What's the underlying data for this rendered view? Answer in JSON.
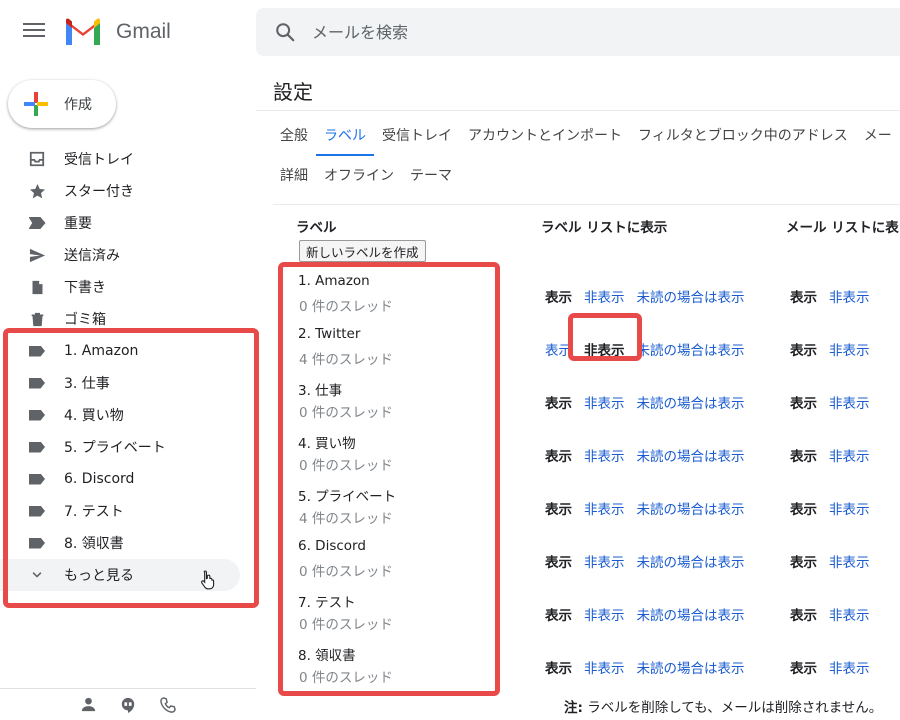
{
  "app": {
    "name": "Gmail"
  },
  "search": {
    "placeholder": "メールを検索"
  },
  "compose": {
    "label": "作成"
  },
  "sidebar": {
    "items": [
      {
        "label": "受信トレイ",
        "icon": "inbox-icon"
      },
      {
        "label": "スター付き",
        "icon": "star-icon"
      },
      {
        "label": "重要",
        "icon": "important-icon"
      },
      {
        "label": "送信済み",
        "icon": "send-icon"
      },
      {
        "label": "下書き",
        "icon": "draft-icon"
      },
      {
        "label": "ゴミ箱",
        "icon": "trash-icon"
      },
      {
        "label": "1. Amazon",
        "icon": "label-icon"
      },
      {
        "label": "3. 仕事",
        "icon": "label-icon"
      },
      {
        "label": "4. 買い物",
        "icon": "label-icon"
      },
      {
        "label": "5. プライベート",
        "icon": "label-icon"
      },
      {
        "label": "6. Discord",
        "icon": "label-icon"
      },
      {
        "label": "7. テスト",
        "icon": "label-icon"
      },
      {
        "label": "8. 領収書",
        "icon": "label-icon"
      }
    ],
    "more_label": "もっと見る"
  },
  "settings": {
    "title": "設定",
    "tabs_row1": [
      "全般",
      "ラベル",
      "受信トレイ",
      "アカウントとインポート",
      "フィルタとブロック中のアドレス",
      "メー"
    ],
    "tabs_row2": [
      "詳細",
      "オフライン",
      "テーマ"
    ],
    "active_tab": "ラベル",
    "headers": {
      "label": "ラベル",
      "label_list": "ラベル リストに表示",
      "message_list": "メール リストに表"
    },
    "new_label_button": "新しいラベルを作成",
    "options": {
      "show": "表示",
      "hide": "非表示",
      "show_if_unread": "未読の場合は表示"
    },
    "labels": [
      {
        "name": "1. Amazon",
        "count": "0 件のスレッド",
        "label_list": "show",
        "message_list": "show"
      },
      {
        "name": "2. Twitter",
        "count": "4 件のスレッド",
        "label_list": "hide",
        "message_list": "show"
      },
      {
        "name": "3. 仕事",
        "count": "0 件のスレッド",
        "label_list": "show",
        "message_list": "show"
      },
      {
        "name": "4. 買い物",
        "count": "0 件のスレッド",
        "label_list": "show",
        "message_list": "show"
      },
      {
        "name": "5. プライベート",
        "count": "4 件のスレッド",
        "label_list": "show",
        "message_list": "show"
      },
      {
        "name": "6. Discord",
        "count": "0 件のスレッド",
        "label_list": "show",
        "message_list": "show"
      },
      {
        "name": "7. テスト",
        "count": "0 件のスレッド",
        "label_list": "show",
        "message_list": "show"
      },
      {
        "name": "8. 領収書",
        "count": "0 件のスレッド",
        "label_list": "show",
        "message_list": "show"
      }
    ],
    "note": {
      "prefix": "注:",
      "text": " ラベルを削除しても、メールは削除されません。"
    }
  },
  "colors": {
    "accent": "#1a73e8",
    "link": "#1a5cd0",
    "highlight": "#e84a4a"
  }
}
